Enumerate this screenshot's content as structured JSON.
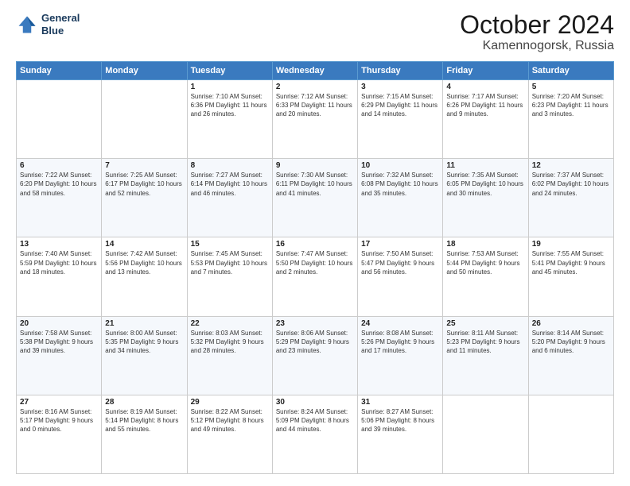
{
  "header": {
    "logo_line1": "General",
    "logo_line2": "Blue",
    "month": "October 2024",
    "location": "Kamennogorsk, Russia"
  },
  "weekdays": [
    "Sunday",
    "Monday",
    "Tuesday",
    "Wednesday",
    "Thursday",
    "Friday",
    "Saturday"
  ],
  "weeks": [
    [
      {
        "day": "",
        "detail": ""
      },
      {
        "day": "",
        "detail": ""
      },
      {
        "day": "1",
        "detail": "Sunrise: 7:10 AM\nSunset: 6:36 PM\nDaylight: 11 hours\nand 26 minutes."
      },
      {
        "day": "2",
        "detail": "Sunrise: 7:12 AM\nSunset: 6:33 PM\nDaylight: 11 hours\nand 20 minutes."
      },
      {
        "day": "3",
        "detail": "Sunrise: 7:15 AM\nSunset: 6:29 PM\nDaylight: 11 hours\nand 14 minutes."
      },
      {
        "day": "4",
        "detail": "Sunrise: 7:17 AM\nSunset: 6:26 PM\nDaylight: 11 hours\nand 9 minutes."
      },
      {
        "day": "5",
        "detail": "Sunrise: 7:20 AM\nSunset: 6:23 PM\nDaylight: 11 hours\nand 3 minutes."
      }
    ],
    [
      {
        "day": "6",
        "detail": "Sunrise: 7:22 AM\nSunset: 6:20 PM\nDaylight: 10 hours\nand 58 minutes."
      },
      {
        "day": "7",
        "detail": "Sunrise: 7:25 AM\nSunset: 6:17 PM\nDaylight: 10 hours\nand 52 minutes."
      },
      {
        "day": "8",
        "detail": "Sunrise: 7:27 AM\nSunset: 6:14 PM\nDaylight: 10 hours\nand 46 minutes."
      },
      {
        "day": "9",
        "detail": "Sunrise: 7:30 AM\nSunset: 6:11 PM\nDaylight: 10 hours\nand 41 minutes."
      },
      {
        "day": "10",
        "detail": "Sunrise: 7:32 AM\nSunset: 6:08 PM\nDaylight: 10 hours\nand 35 minutes."
      },
      {
        "day": "11",
        "detail": "Sunrise: 7:35 AM\nSunset: 6:05 PM\nDaylight: 10 hours\nand 30 minutes."
      },
      {
        "day": "12",
        "detail": "Sunrise: 7:37 AM\nSunset: 6:02 PM\nDaylight: 10 hours\nand 24 minutes."
      }
    ],
    [
      {
        "day": "13",
        "detail": "Sunrise: 7:40 AM\nSunset: 5:59 PM\nDaylight: 10 hours\nand 18 minutes."
      },
      {
        "day": "14",
        "detail": "Sunrise: 7:42 AM\nSunset: 5:56 PM\nDaylight: 10 hours\nand 13 minutes."
      },
      {
        "day": "15",
        "detail": "Sunrise: 7:45 AM\nSunset: 5:53 PM\nDaylight: 10 hours\nand 7 minutes."
      },
      {
        "day": "16",
        "detail": "Sunrise: 7:47 AM\nSunset: 5:50 PM\nDaylight: 10 hours\nand 2 minutes."
      },
      {
        "day": "17",
        "detail": "Sunrise: 7:50 AM\nSunset: 5:47 PM\nDaylight: 9 hours\nand 56 minutes."
      },
      {
        "day": "18",
        "detail": "Sunrise: 7:53 AM\nSunset: 5:44 PM\nDaylight: 9 hours\nand 50 minutes."
      },
      {
        "day": "19",
        "detail": "Sunrise: 7:55 AM\nSunset: 5:41 PM\nDaylight: 9 hours\nand 45 minutes."
      }
    ],
    [
      {
        "day": "20",
        "detail": "Sunrise: 7:58 AM\nSunset: 5:38 PM\nDaylight: 9 hours\nand 39 minutes."
      },
      {
        "day": "21",
        "detail": "Sunrise: 8:00 AM\nSunset: 5:35 PM\nDaylight: 9 hours\nand 34 minutes."
      },
      {
        "day": "22",
        "detail": "Sunrise: 8:03 AM\nSunset: 5:32 PM\nDaylight: 9 hours\nand 28 minutes."
      },
      {
        "day": "23",
        "detail": "Sunrise: 8:06 AM\nSunset: 5:29 PM\nDaylight: 9 hours\nand 23 minutes."
      },
      {
        "day": "24",
        "detail": "Sunrise: 8:08 AM\nSunset: 5:26 PM\nDaylight: 9 hours\nand 17 minutes."
      },
      {
        "day": "25",
        "detail": "Sunrise: 8:11 AM\nSunset: 5:23 PM\nDaylight: 9 hours\nand 11 minutes."
      },
      {
        "day": "26",
        "detail": "Sunrise: 8:14 AM\nSunset: 5:20 PM\nDaylight: 9 hours\nand 6 minutes."
      }
    ],
    [
      {
        "day": "27",
        "detail": "Sunrise: 8:16 AM\nSunset: 5:17 PM\nDaylight: 9 hours\nand 0 minutes."
      },
      {
        "day": "28",
        "detail": "Sunrise: 8:19 AM\nSunset: 5:14 PM\nDaylight: 8 hours\nand 55 minutes."
      },
      {
        "day": "29",
        "detail": "Sunrise: 8:22 AM\nSunset: 5:12 PM\nDaylight: 8 hours\nand 49 minutes."
      },
      {
        "day": "30",
        "detail": "Sunrise: 8:24 AM\nSunset: 5:09 PM\nDaylight: 8 hours\nand 44 minutes."
      },
      {
        "day": "31",
        "detail": "Sunrise: 8:27 AM\nSunset: 5:06 PM\nDaylight: 8 hours\nand 39 minutes."
      },
      {
        "day": "",
        "detail": ""
      },
      {
        "day": "",
        "detail": ""
      }
    ]
  ]
}
